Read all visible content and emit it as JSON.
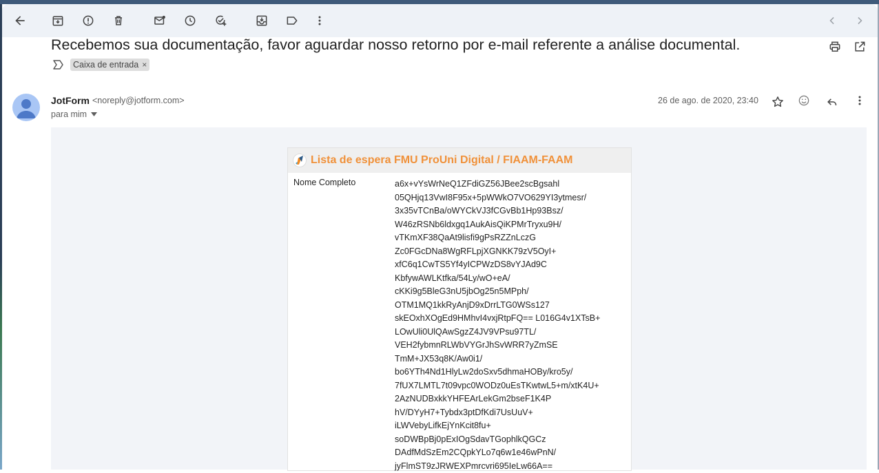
{
  "toolbar": {
    "back": "back-arrow",
    "archive": "archive",
    "spam": "report-spam",
    "delete": "delete",
    "mark_unread": "mark-unread",
    "snooze": "snooze",
    "add_task": "add-to-tasks",
    "move": "move-to",
    "labels": "labels",
    "more": "more",
    "prev": "older",
    "next": "newer"
  },
  "email": {
    "subject": "Recebemos sua documentação, favor aguardar nosso retorno por e-mail referente a análise documental.",
    "label": "Caixa de entrada",
    "label_close": "×",
    "sender_name": "JotForm",
    "sender_email": "<noreply@jotform.com>",
    "recipient": "para mim",
    "date": "26 de ago. de 2020, 23:40"
  },
  "form": {
    "title": "Lista de espera FMU ProUni Digital / FIAAM-FAAM",
    "field_label": "Nome Completo",
    "value_lines": [
      "a6x+vYsWrNeQ1ZFdiGZ56JBee2scBgsahl",
      "05QHjq13VwI8F95x+5pWWkO7VO629YI3ytmesr/",
      "3x35vTCnBa/oWYCkVJ3fCGvBb1Hp93Bsz/",
      "W46zRSNb6ldxgq1AukAisQiKPMrTryxu9H/",
      "vTKmXF38QaAt9lisfi9gPsRZZnLczG",
      "Zc0FGcDNa8WgRFLpjXGNKK79zV5OyI+",
      "xfC6q1CwTS5Yf4yICPWzDS8vYJAd9C",
      "KbfywAWLKtfka/54Ly/wO+eA/",
      "cKKi9g5BleG3nU5jbOg25n5MPph/",
      "OTM1MQ1kkRyAnjD9xDrrLTG0WSs127",
      "skEOxhXOgEd9HMhvI4vxjRtpFQ== L016G4v1XTsB+",
      "LOwUli0UlQAwSgzZ4JV9VPsu97TL/",
      "VEH2fybmnRLWbVYGrJhSvWRR7yZmSE",
      "TmM+JX53q8K/Aw0i1/",
      "bo6YTh4Nd1HlyLw2doSxv5dhmaHOBy/kro5y/",
      "7fUX7LMTL7t09vpc0WODz0uEsTKwtwL5+m/xtK4U+",
      "2AzNUDBxkkYHFEArLekGm2bseF1K4P",
      "hV/DYyH7+Tybdx3ptDfKdi7UsUuV+",
      "iLWVebyLifkEjYnKcit8fu+",
      "soDWBpBj0pExIOgSdavTGophlkQGCz",
      "DAdfMdSzEm2CQpkYLo7q6w1e46wPnN/",
      "jyFlmST9zJRWEXPmrcvri695IeLw66A=="
    ]
  },
  "colors": {
    "toolbar_bg": "#eef2f7",
    "body_bg": "#f2f4f8",
    "form_title": "#f0913a",
    "avatar": "#a9c6f5"
  }
}
